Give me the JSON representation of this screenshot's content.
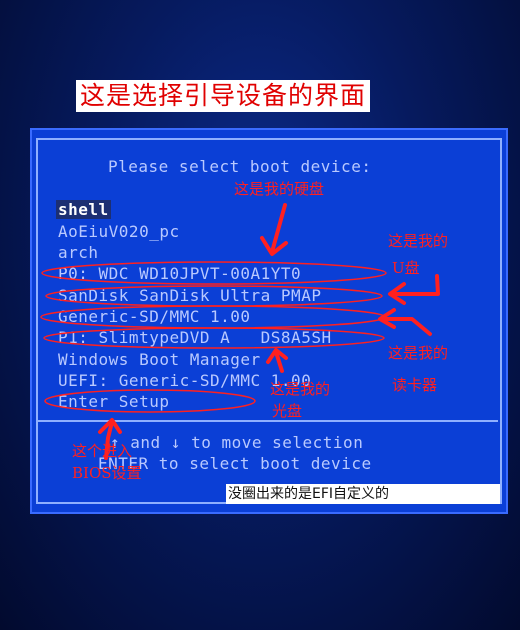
{
  "banner": "这是选择引导设备的界面",
  "boot_menu": {
    "title": "Please select boot device:",
    "items": [
      "shell",
      "AoEiuV020_pc",
      "arch",
      "P0: WDC WD10JPVT-00A1YT0",
      "SanDisk SanDisk Ultra PMAP",
      "Generic-SD/MMC 1.00",
      "P1: SlimtypeDVD A   DS8A5SH",
      "Windows Boot Manager",
      "UEFI: Generic-SD/MMC 1.00",
      "Enter Setup"
    ],
    "help_line1": "↑ and ↓ to move selection",
    "help_line2": "ENTER to select boot device"
  },
  "annotations": {
    "hard_disk": "这是我的硬盘",
    "usb_line1": "这是我的",
    "usb_line2": "U盘",
    "card_reader_line1": "这是我的",
    "card_reader_line2": "读卡器",
    "optical_line1": "这是我的",
    "optical_line2": "光盘",
    "bios_line1": "这个进入",
    "bios_line2": "BIOS设置",
    "efi_note": "没圈出来的是EFI自定义的"
  },
  "colors": {
    "screen_blue": "#0b3fd6",
    "text": "#b9c9ff",
    "annotation_red": "#ff2020"
  }
}
